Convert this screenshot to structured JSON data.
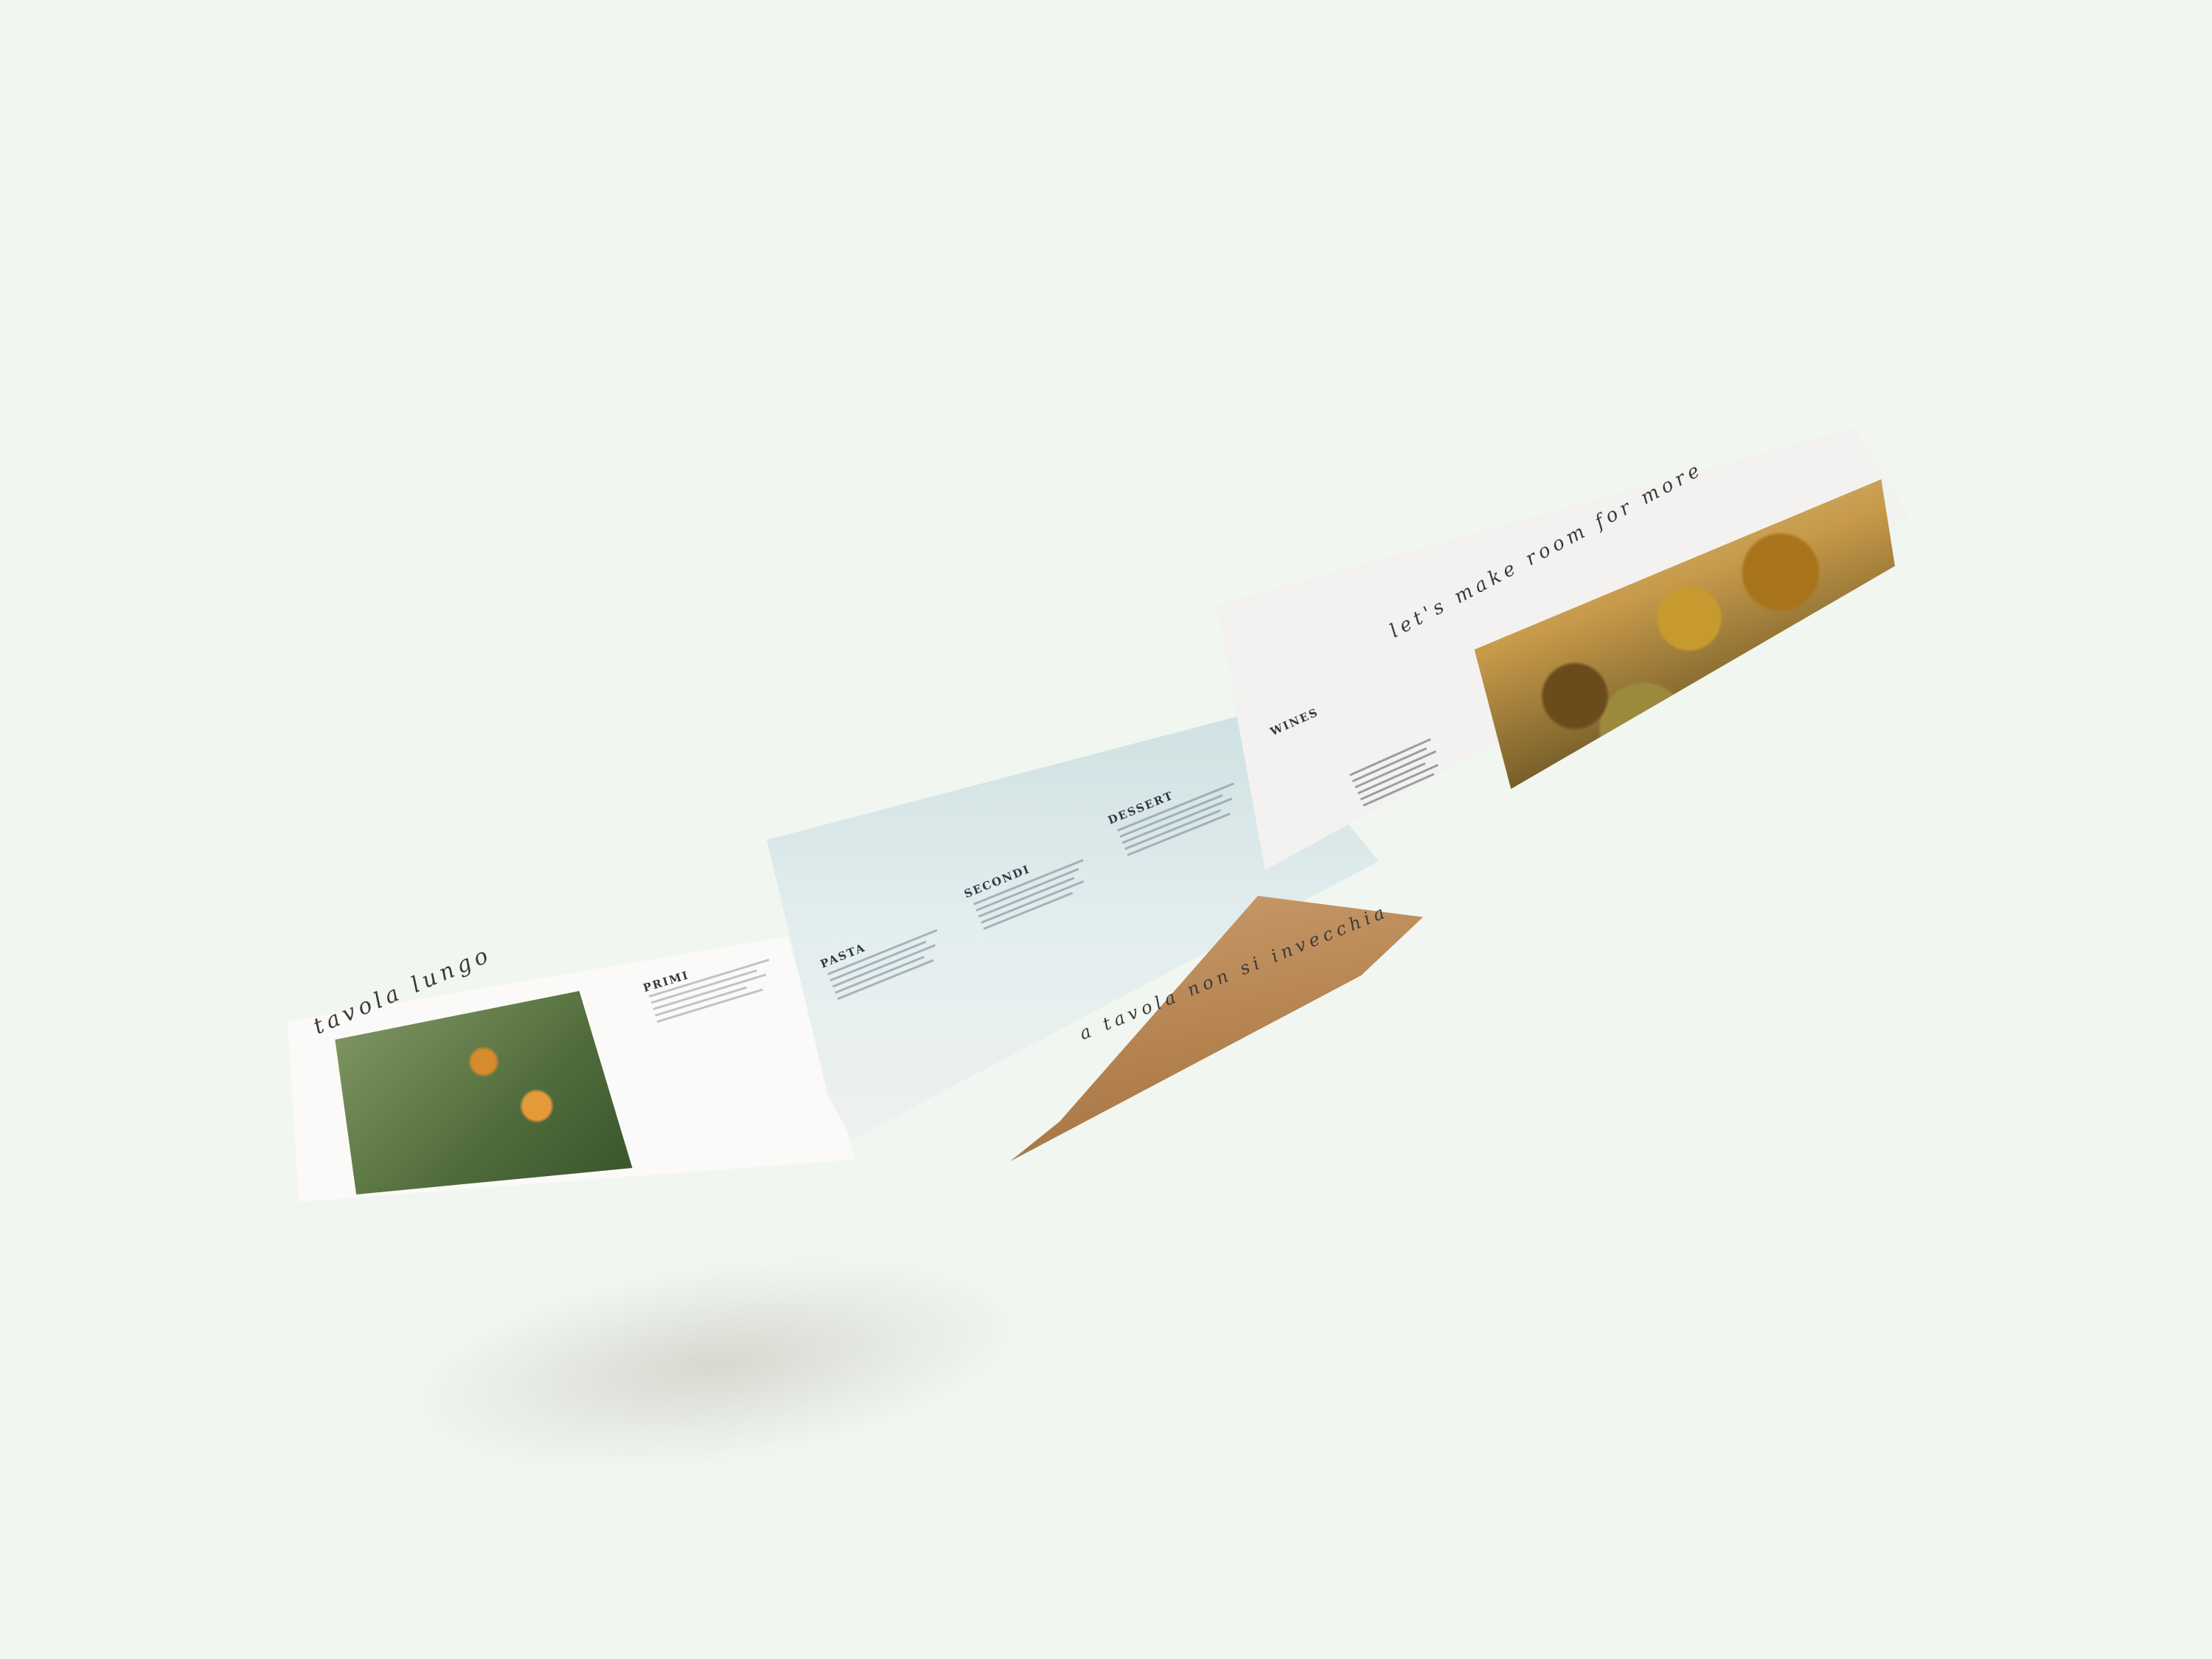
{
  "menu": {
    "left_script": "tavola lungo",
    "primi_heading": "PRIMI",
    "pasta_heading": "PASTA",
    "secondi_heading": "SECONDI",
    "dessert_heading": "DESSERT",
    "wines_heading": "WINES",
    "mid_script": "a tavola non si invecchia",
    "right_script": "let's make room for more"
  }
}
